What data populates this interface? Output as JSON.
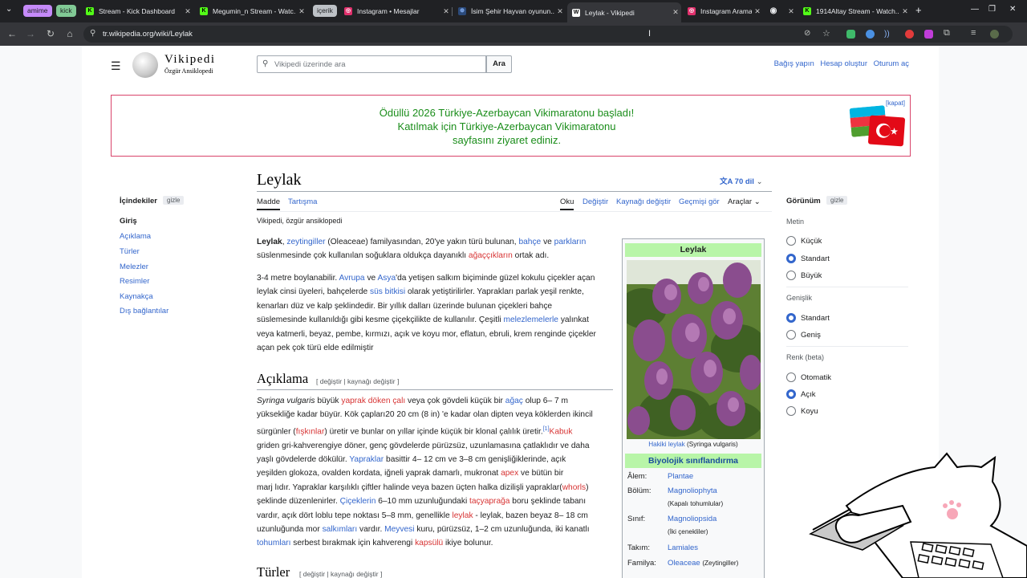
{
  "browser": {
    "tab_groups": [
      {
        "label": "amime",
        "color": "#c58af9"
      },
      {
        "label": "kick",
        "color": "#81c995"
      },
      {
        "label": "içerik",
        "color": "#bdc1c6"
      }
    ],
    "tabs": [
      {
        "title": "Stream - Kick Dashboard",
        "favicon": "kick-icon",
        "fav_letter": "K",
        "fav_color": "#53fc18"
      },
      {
        "title": "Megumin_n Stream - Watc...",
        "favicon": "kick-icon",
        "fav_letter": "K",
        "fav_color": "#53fc18"
      },
      {
        "title": "Instagram • Mesajlar",
        "favicon": "instagram-icon",
        "fav_letter": "◎",
        "fav_color": "#e1306c"
      },
      {
        "title": "İsim Şehir Hayvan oyunun...",
        "favicon": "globe-icon",
        "fav_letter": "⊕",
        "fav_color": "#8ab4f8"
      },
      {
        "title": "Leylak - Vikipedi",
        "favicon": "wikipedia-icon",
        "fav_letter": "W",
        "fav_color": "#ffffff"
      },
      {
        "title": "Instagram Araması",
        "favicon": "instagram-icon",
        "fav_letter": "◎",
        "fav_color": "#e1306c"
      },
      {
        "title": "",
        "favicon": "circle-icon",
        "fav_letter": "◉",
        "fav_color": "#e8eaed"
      },
      {
        "title": "1914Altay Stream - Watch...",
        "favicon": "kick-icon",
        "fav_letter": "K",
        "fav_color": "#53fc18"
      }
    ],
    "url": "tr.wikipedia.org/wiki/Leylak"
  },
  "wiki": {
    "logo_title": "Vikipedi",
    "logo_sub": "Özgür Ansiklopedi",
    "search_placeholder": "Vikipedi üzerinde ara",
    "search_button": "Ara",
    "top_links": [
      "Bağış yapın",
      "Hesap oluştur",
      "Oturum aç"
    ],
    "banner": {
      "line1": "Ödüllü 2026 Türkiye-Azerbaycan Vikimaratonu başladı!",
      "line2": "Katılmak için Türkiye-Azerbaycan Vikimaratonu",
      "line3": "sayfasını ziyaret ediniz.",
      "close": "[kapat]"
    },
    "title": "Leylak",
    "languages": "70 dil",
    "tabs_left": [
      "Madde",
      "Tartışma"
    ],
    "tabs_right": [
      "Oku",
      "Değiştir",
      "Kaynağı değiştir",
      "Geçmişi gör",
      "Araçlar"
    ],
    "from": "Vikipedi, özgür ansiklopedi",
    "toc": {
      "heading": "İçindekiler",
      "hide": "gizle",
      "items": [
        "Giriş",
        "Açıklama",
        "Türler",
        "Melezler",
        "Resimler",
        "Kaynakça",
        "Dış bağlantılar"
      ]
    },
    "appearance": {
      "heading": "Görünüm",
      "hide": "gizle",
      "text_label": "Metin",
      "text_options": [
        "Küçük",
        "Standart",
        "Büyük"
      ],
      "width_label": "Genişlik",
      "width_options": [
        "Standart",
        "Geniş"
      ],
      "color_label": "Renk (beta)",
      "color_options": [
        "Otomatik",
        "Açık",
        "Koyu"
      ]
    },
    "section_edit": "[ değiştir | kaynağı değiştir ]",
    "sections": [
      "Açıklama",
      "Türler"
    ],
    "intro": {
      "l1": [
        "Leylak",
        ", ",
        "zeytingiller",
        " (Oleaceae) familyasından, 20'ye yakın türü bulunan, ",
        "bahçe",
        " ve ",
        "parkların"
      ],
      "l2": [
        "süslenmesinde çok kullanılan soğuklara oldukça dayanıklı ",
        "ağaççıkların",
        " ortak adı."
      ]
    },
    "p2": {
      "l1": [
        "3-4 metre boylanabilir. ",
        "Avrupa",
        " ve ",
        "Asya",
        "'da yetişen salkım biçiminde güzel kokulu çiçekler açan"
      ],
      "l2": [
        "leylak cinsi üyeleri, bahçelerde ",
        "süs bitkisi",
        " olarak yetiştirilirler. Yaprakları parlak yeşil renkte,"
      ],
      "l3": "kenarları düz ve kalp şeklindedir. Bir yıllık dalları üzerinde bulunan çiçekleri bahçe",
      "l4": [
        "süslemesinde kullanıldığı gibi kesme çiçekçilikte de kullanılır. Çeşitli ",
        "melezlemelerle",
        " yalınkat"
      ],
      "l5": "veya katmerli, beyaz, pembe, kırmızı, açık ve koyu mor, eflatun, ebruli, krem renginde çiçekler",
      "l6": "açan pek çok türü elde edilmiştir"
    },
    "desc": {
      "l1": [
        "Syringa vulgaris",
        " büyük ",
        "yaprak döken çalı",
        " veya çok gövdeli küçük bir ",
        "ağaç",
        " olup 6– 7 m"
      ],
      "l2": "yüksekliğe kadar büyür. Kök çapları20 20 cm (8 in) 'e kadar olan dipten veya köklerden ikincil",
      "l3": [
        "sürgünler (",
        "fışkınlar",
        ") üretir ve bunlar on yıllar içinde küçük bir klonal çalılık üretir.",
        "[1]",
        "Kabuk"
      ],
      "l4": "griden gri-kahverengiye döner, genç gövdelerde pürüzsüz, uzunlamasına çatlaklıdır ve daha",
      "l5": [
        "yaşlı gövdelerde dökülür. ",
        "Yapraklar",
        " basittir 4– 12 cm ve 3–8 cm genişliğiklerinde, açık"
      ],
      "l6": [
        "yeşilden glokoza, ovalden kordata, iğneli yaprak damarlı, mukronat ",
        "apex",
        " ve bütün bir"
      ],
      "l7": [
        "marj lıdır. Yapraklar karşılıklı çiftler halinde veya bazen üçten halka dizilişli yapraklar(",
        "whorls",
        ")"
      ],
      "l8": [
        "şeklinde düzenlenirler. ",
        "Çiçeklerin",
        " 6–10 mm uzunluğundaki ",
        "taçyaprağa",
        " boru şeklinde tabanı"
      ],
      "l9": [
        "vardır, açık dört loblu tepe noktası 5–8 mm, genellikle ",
        "leylak",
        " - leylak, bazen beyaz  8– 18 cm"
      ],
      "l10": [
        "uzunluğunda mor ",
        "salkımları",
        " vardır. ",
        "Meyvesi",
        " kuru, pürüzsüz, 1–2 cm uzunluğunda, iki kanatlı"
      ],
      "l11": [
        "tohumları",
        " serbest bırakmak için kahverengi ",
        "kapsülü",
        " ikiye bolunur."
      ]
    },
    "infobox": {
      "title": "Leylak",
      "caption_link": "Hakiki leylak",
      "caption_rest": " (Syringa vulgaris)",
      "class_header": "Biyolojik sınıflandırma",
      "rows": [
        {
          "key": "Âlem:",
          "value": "Plantae",
          "sub": ""
        },
        {
          "key": "Bölüm:",
          "value": "Magnoliophyta",
          "sub": "(Kapalı tohumlular)"
        },
        {
          "key": "Sınıf:",
          "value": "Magnoliopsida",
          "sub": "(İki çenekliler)"
        },
        {
          "key": "Takım:",
          "value": "Lamiales",
          "sub": ""
        },
        {
          "key": "Familya:",
          "value": "Oleaceae",
          "sub": "(Zeytingiller)"
        }
      ]
    }
  },
  "colors": {
    "link": "#3366cc",
    "redlink": "#d73333",
    "banner_text": "#1a8d1a",
    "infobox_header": "#b8f5a8",
    "chrome_bg": "#202124"
  }
}
